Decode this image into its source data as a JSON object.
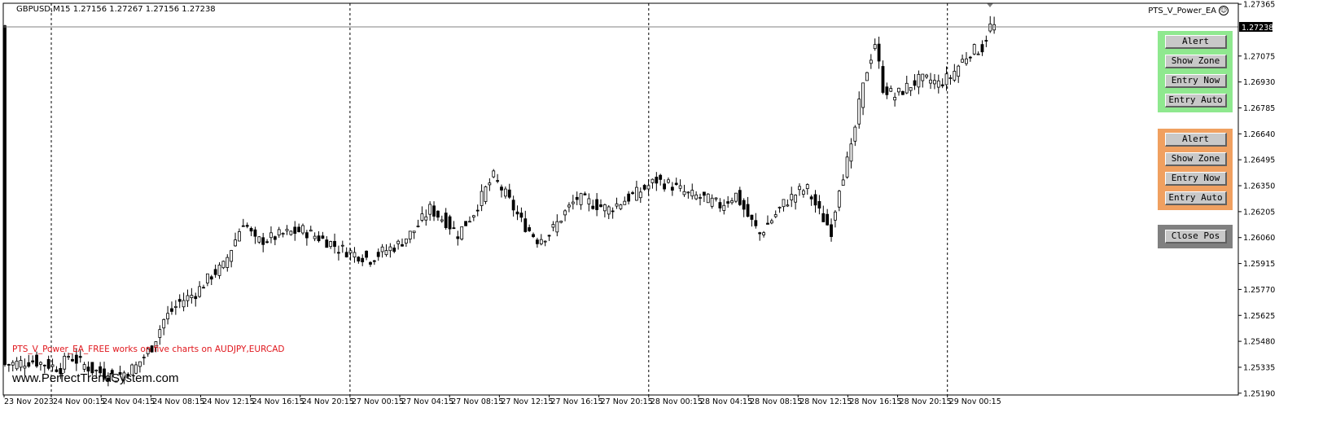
{
  "header": {
    "symbol_info": "GBPUSD,M15  1.27156 1.27267 1.27156 1.27238"
  },
  "ea_name": "PTS_V_Power_EA",
  "note": "PTS_V_Power_EA_FREE works on five charts on AUDJPY,EURCAD",
  "website": "www.PerfectTrendSystem.com",
  "panels": {
    "green": {
      "color": "#8fe88f",
      "buttons": [
        "Alert",
        "Show Zone",
        "Entry Now",
        "Entry Auto"
      ]
    },
    "orange": {
      "color": "#f0a060",
      "buttons": [
        "Alert",
        "Show Zone",
        "Entry Now",
        "Entry Auto"
      ]
    },
    "grey": {
      "color": "#808080",
      "buttons": [
        "Close Pos"
      ]
    }
  },
  "chart_data": {
    "type": "candlestick",
    "symbol": "GBPUSD",
    "timeframe": "M15",
    "last_price": "1.27238",
    "ylim": [
      1.2518,
      1.2737
    ],
    "y_ticks": [
      "1.27365",
      "1.27075",
      "1.26930",
      "1.26785",
      "1.26640",
      "1.26495",
      "1.26350",
      "1.26205",
      "1.26060",
      "1.25915",
      "1.25770",
      "1.25625",
      "1.25480",
      "1.25335",
      "1.25190"
    ],
    "x_ticks": [
      "23 Nov 2023",
      "24 Nov 00:15",
      "24 Nov 04:15",
      "24 Nov 08:15",
      "24 Nov 12:15",
      "24 Nov 16:15",
      "24 Nov 20:15",
      "27 Nov 00:15",
      "27 Nov 04:15",
      "27 Nov 08:15",
      "27 Nov 12:15",
      "27 Nov 16:15",
      "27 Nov 20:15",
      "28 Nov 00:15",
      "28 Nov 04:15",
      "28 Nov 08:15",
      "28 Nov 12:15",
      "28 Nov 16:15",
      "28 Nov 20:15",
      "29 Nov 00:15"
    ],
    "day_separators": [
      "24 Nov 00:15",
      "27 Nov 00:15",
      "28 Nov 00:15",
      "29 Nov 00:15"
    ],
    "close_path": [
      [
        0,
        1.2535
      ],
      [
        7,
        1.2537
      ],
      [
        14,
        1.2533
      ],
      [
        16,
        1.254
      ],
      [
        22,
        1.2532
      ],
      [
        28,
        1.2528
      ],
      [
        33,
        1.2534
      ],
      [
        37,
        1.2545
      ],
      [
        40,
        1.256
      ],
      [
        44,
        1.257
      ],
      [
        48,
        1.2575
      ],
      [
        52,
        1.2585
      ],
      [
        55,
        1.259
      ],
      [
        58,
        1.2605
      ],
      [
        60,
        1.2615
      ],
      [
        61,
        1.2612
      ],
      [
        63,
        1.2604
      ],
      [
        66,
        1.2605
      ],
      [
        70,
        1.2608
      ],
      [
        75,
        1.261
      ],
      [
        79,
        1.2606
      ],
      [
        82,
        1.2603
      ],
      [
        84,
        1.26
      ],
      [
        88,
        1.2597
      ],
      [
        92,
        1.2594
      ],
      [
        95,
        1.2598
      ],
      [
        99,
        1.2602
      ],
      [
        103,
        1.261
      ],
      [
        107,
        1.2622
      ],
      [
        111,
        1.2615
      ],
      [
        114,
        1.2608
      ],
      [
        118,
        1.262
      ],
      [
        121,
        1.2633
      ],
      [
        123,
        1.264
      ],
      [
        126,
        1.263
      ],
      [
        130,
        1.2615
      ],
      [
        134,
        1.2605
      ],
      [
        137,
        1.2608
      ],
      [
        141,
        1.262
      ],
      [
        144,
        1.2628
      ],
      [
        148,
        1.2625
      ],
      [
        152,
        1.2622
      ],
      [
        156,
        1.2627
      ],
      [
        160,
        1.2632
      ],
      [
        164,
        1.2638
      ],
      [
        168,
        1.2635
      ],
      [
        172,
        1.263
      ],
      [
        176,
        1.2628
      ],
      [
        180,
        1.2624
      ],
      [
        184,
        1.263
      ],
      [
        187,
        1.2618
      ],
      [
        190,
        1.2608
      ],
      [
        193,
        1.2616
      ],
      [
        196,
        1.2625
      ],
      [
        200,
        1.2632
      ],
      [
        202,
        1.2633
      ],
      [
        205,
        1.262
      ],
      [
        208,
        1.261
      ],
      [
        210,
        1.2635
      ],
      [
        213,
        1.2655
      ],
      [
        215,
        1.268
      ],
      [
        217,
        1.27
      ],
      [
        219,
        1.2715
      ],
      [
        221,
        1.269
      ],
      [
        224,
        1.2685
      ],
      [
        227,
        1.269
      ],
      [
        230,
        1.2694
      ],
      [
        233,
        1.2694
      ],
      [
        235,
        1.2692
      ],
      [
        238,
        1.2696
      ],
      [
        241,
        1.2705
      ],
      [
        243,
        1.271
      ],
      [
        246,
        1.2712
      ],
      [
        248,
        1.2724
      ]
    ]
  }
}
